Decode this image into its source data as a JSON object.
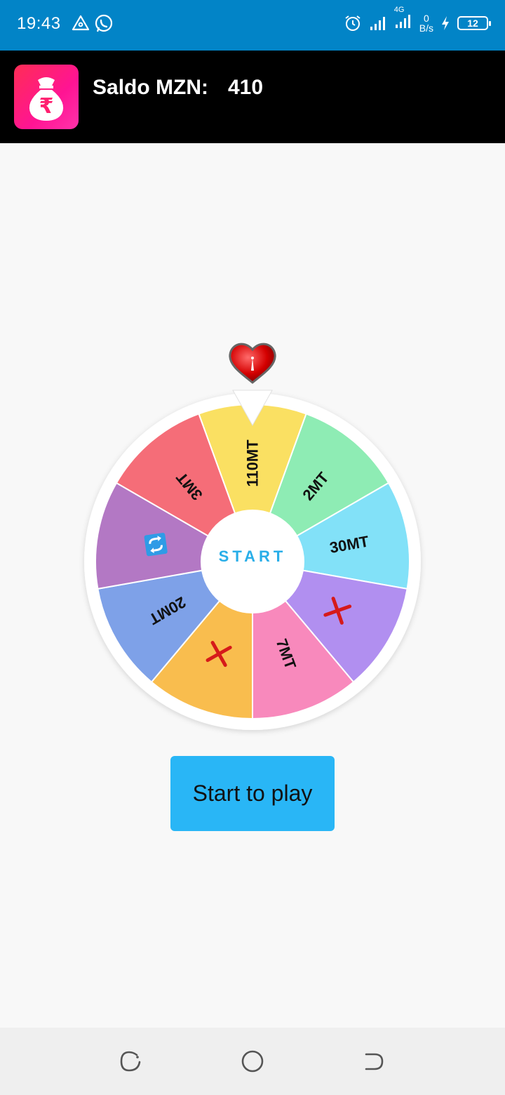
{
  "status_bar": {
    "time": "19:43",
    "network": "4G",
    "speed_value": "0",
    "speed_unit": "B/s",
    "battery": "12",
    "icons": [
      "triangle-alert-icon",
      "whatsapp-icon",
      "alarm-icon",
      "signal-icon",
      "signal-4g-icon",
      "charging-icon",
      "battery-icon"
    ]
  },
  "header": {
    "balance_label": "Saldo MZN:",
    "balance_value": "410",
    "logo_icon": "money-bag-rupee-icon",
    "logo_glyph": "₹"
  },
  "wheel": {
    "center_label": "START",
    "pointer_icon": "heart-pointer-icon",
    "colors": {
      "yellow": "#fae062",
      "green": "#8eecb4",
      "cyan": "#82e1f8",
      "violet": "#b18ff0",
      "pink": "#f889bc",
      "orange": "#f9bd4e",
      "blue": "#7ea1e8",
      "purple": "#b378c4",
      "red": "#f56d78"
    },
    "segments": [
      {
        "label": "110MT",
        "color": "#fae062",
        "icon": null
      },
      {
        "label": "2MT",
        "color": "#8eecb4",
        "icon": null
      },
      {
        "label": "30MT",
        "color": "#82e1f8",
        "icon": null
      },
      {
        "label": "",
        "color": "#b18ff0",
        "icon": "x-icon"
      },
      {
        "label": "7MT",
        "color": "#f889bc",
        "icon": null
      },
      {
        "label": "",
        "color": "#f9bd4e",
        "icon": "x-icon"
      },
      {
        "label": "20MT",
        "color": "#7ea1e8",
        "icon": null
      },
      {
        "label": "",
        "color": "#b378c4",
        "icon": "refresh-icon"
      },
      {
        "label": "3MT",
        "color": "#f56d78",
        "icon": null
      }
    ]
  },
  "play_button": {
    "label": "Start to play",
    "color": "#29b6f6"
  },
  "nav_bar": {
    "icons": [
      "recents-icon",
      "home-icon",
      "back-icon"
    ]
  }
}
